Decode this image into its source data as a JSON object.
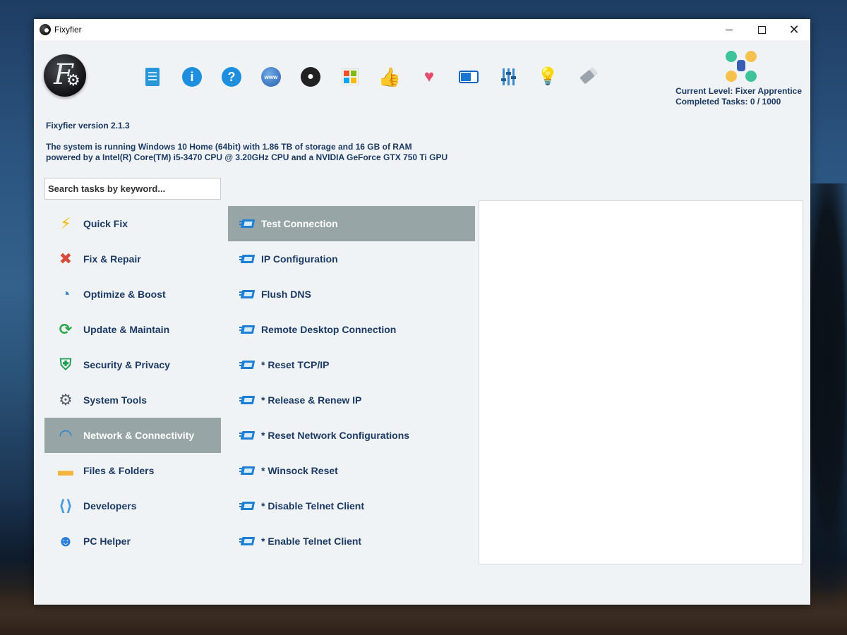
{
  "window": {
    "title": "Fixyfier"
  },
  "toolbar": {
    "icons": [
      "document-icon",
      "info-icon",
      "help-icon",
      "www-icon",
      "github-icon",
      "store-icon",
      "thumbs-up-icon",
      "donate-heart-icon",
      "toggle-theme-icon",
      "settings-sliders-icon",
      "lightbulb-icon",
      "eraser-icon"
    ]
  },
  "status": {
    "level": "Current Level: Fixer Apprentice",
    "tasks": "Completed Tasks: 0 / 1000"
  },
  "info": {
    "version": "Fixyfier version 2.1.3",
    "system_line1": "The system is running Windows 10 Home (64bit) with 1.86 TB of storage and 16 GB of RAM",
    "system_line2": "powered by a Intel(R) Core(TM) i5-3470 CPU @ 3.20GHz CPU and a NVIDIA GeForce GTX 750 Ti GPU"
  },
  "search": {
    "placeholder": "Search tasks by keyword..."
  },
  "categories": [
    {
      "label": "Quick Fix",
      "icon": "lightning-icon",
      "color": "#f5b800"
    },
    {
      "label": "Fix & Repair",
      "icon": "tools-icon",
      "color": "#d84a3a"
    },
    {
      "label": "Optimize & Boost",
      "icon": "speedometer-icon",
      "color": "#3a87c9"
    },
    {
      "label": "Update & Maintain",
      "icon": "refresh-icon",
      "color": "#2ba84a"
    },
    {
      "label": "Security & Privacy",
      "icon": "shield-icon",
      "color": "#1f9d55"
    },
    {
      "label": "System Tools",
      "icon": "gear-icon",
      "color": "#555f69"
    },
    {
      "label": "Network & Connectivity",
      "icon": "wifi-icon",
      "color": "#1e7fd4",
      "active": true
    },
    {
      "label": "Files & Folders",
      "icon": "folder-icon",
      "color": "#f2b53a"
    },
    {
      "label": "Developers",
      "icon": "code-file-icon",
      "color": "#4a9be0"
    },
    {
      "label": "PC Helper",
      "icon": "robot-icon",
      "color": "#2a7fd6"
    }
  ],
  "tasks": [
    {
      "label": "Test Connection",
      "active": true
    },
    {
      "label": "IP Configuration"
    },
    {
      "label": "Flush DNS"
    },
    {
      "label": "Remote Desktop Connection"
    },
    {
      "label": "* Reset TCP/IP"
    },
    {
      "label": "* Release & Renew IP"
    },
    {
      "label": "* Reset Network Configurations"
    },
    {
      "label": "* Winsock Reset"
    },
    {
      "label": "* Disable Telnet Client"
    },
    {
      "label": "* Enable Telnet Client"
    }
  ]
}
